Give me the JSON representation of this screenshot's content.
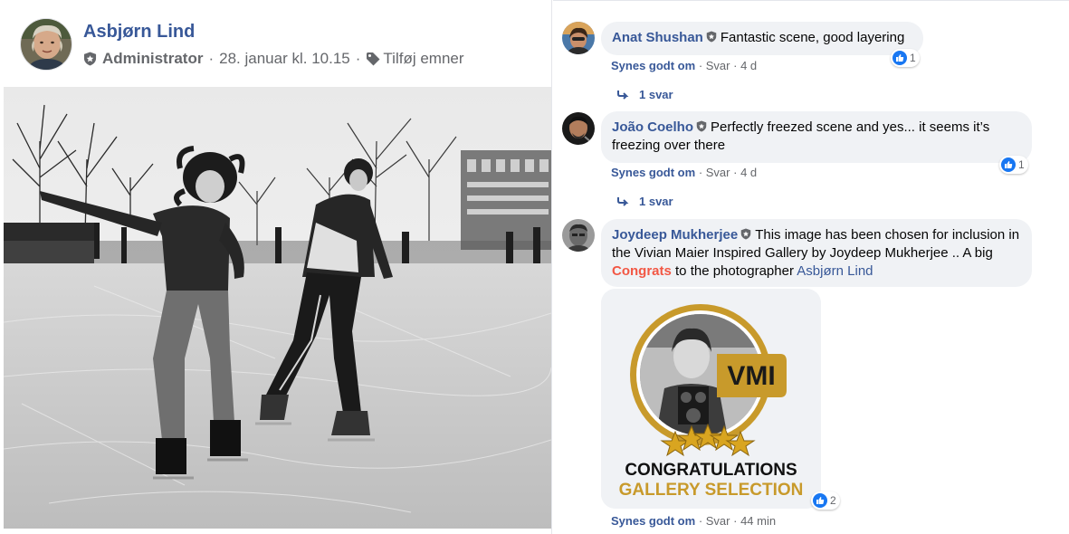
{
  "post": {
    "author": "Asbjørn Lind",
    "role": "Administrator",
    "separator": "·",
    "timestamp": "28. januar kl. 10.15",
    "add_topics": "Tilføj emner",
    "avatar_icon": "person-avatar",
    "photo_icon": "photo-bw-skaters"
  },
  "comments": [
    {
      "author": "Anat Shushan",
      "text": "Fantastic scene, good layering",
      "like_label": "Synes godt om",
      "reply_label": "Svar",
      "time": "4 d",
      "reaction_count": "1",
      "replies_label": "1 svar"
    },
    {
      "author": "João Coelho",
      "text": "Perfectly freezed scene and yes... it seems it’s freezing over there",
      "like_label": "Synes godt om",
      "reply_label": "Svar",
      "time": "4 d",
      "reaction_count": "1",
      "replies_label": "1 svar"
    },
    {
      "author": "Joydeep Mukherjee",
      "text_before": "This image has been chosen for inclusion in the Vivian Maier Inspired Gallery by Joydeep Mukherjee .. A big",
      "highlight": "Congrats",
      "text_middle": "to the photographer",
      "mention": "Asbjørn Lind",
      "like_label": "Synes godt om",
      "reply_label": "Svar",
      "time": "44 min",
      "reaction_count": "2",
      "badge": {
        "logo_text": "VMI",
        "line1": "CONGRATULATIONS",
        "line2": "GALLERY SELECTION"
      }
    }
  ],
  "colors": {
    "link_blue": "#385898",
    "like_blue": "#1877f2",
    "bubble_gray": "#f0f2f5",
    "secondary_text": "#65676b",
    "congrats_red": "#f25744",
    "gold": "#c89a2b"
  },
  "icons": [
    "admin-shield-icon",
    "tag-icon",
    "like-thumb-icon",
    "reply-arrow-icon",
    "star-icon"
  ]
}
